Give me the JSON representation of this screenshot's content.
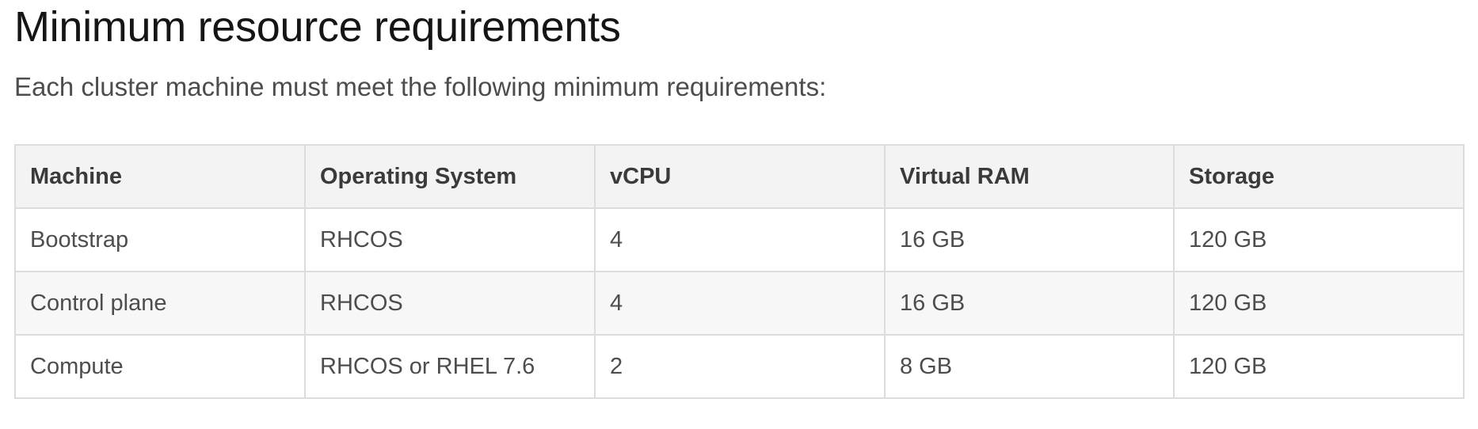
{
  "heading": "Minimum resource requirements",
  "intro": "Each cluster machine must meet the following minimum requirements:",
  "table": {
    "headers": [
      "Machine",
      "Operating System",
      "vCPU",
      "Virtual RAM",
      "Storage"
    ],
    "rows": [
      [
        "Bootstrap",
        "RHCOS",
        "4",
        "16 GB",
        "120 GB"
      ],
      [
        "Control plane",
        "RHCOS",
        "4",
        "16 GB",
        "120 GB"
      ],
      [
        "Compute",
        "RHCOS or RHEL 7.6",
        "2",
        "8 GB",
        "120 GB"
      ]
    ]
  }
}
